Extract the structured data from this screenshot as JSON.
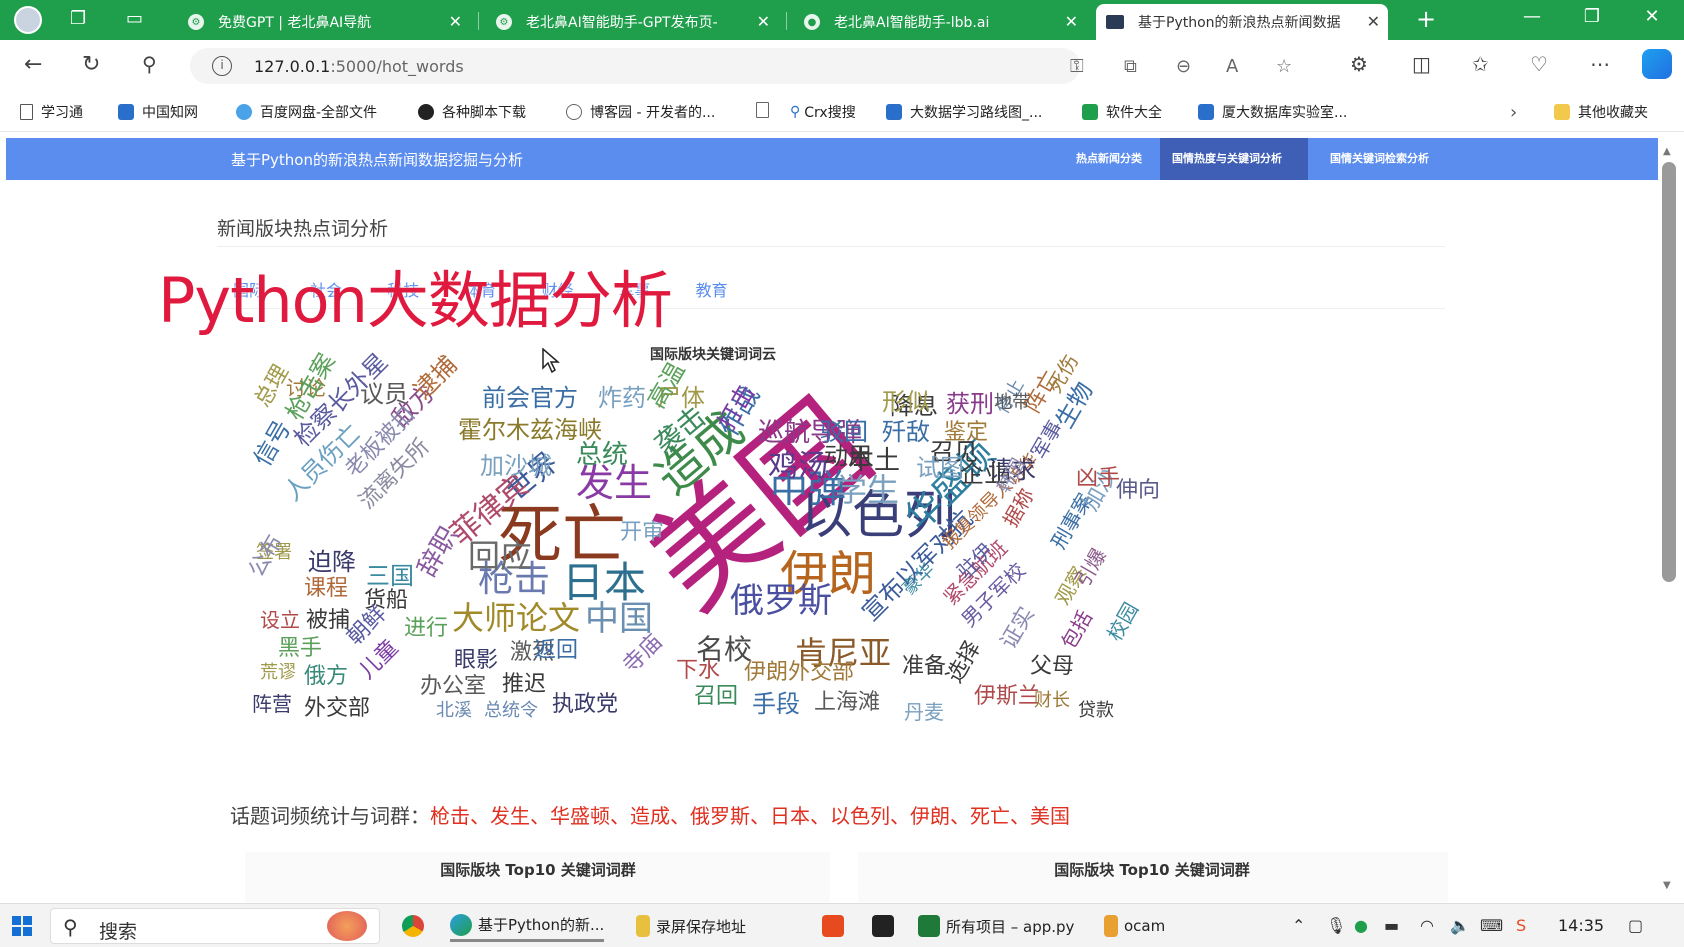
{
  "browser": {
    "tabs": [
      {
        "label": "免费GPT | 老北鼻AI导航",
        "active": false
      },
      {
        "label": "老北鼻AI智能助手-GPT发布页-",
        "active": false
      },
      {
        "label": "老北鼻AI智能助手-lbb.ai",
        "active": false
      },
      {
        "label": "基于Python的新浪热点新闻数据",
        "active": true
      }
    ],
    "url_host": "127.0.0.1",
    "url_path": ":5000/hot_words",
    "bookmarks": [
      {
        "label": "学习通",
        "color": "#555555"
      },
      {
        "label": "中国知网",
        "color": "#2a6fc9"
      },
      {
        "label": "百度网盘-全部文件",
        "color": "#4aa3e8"
      },
      {
        "label": "各种脚本下载",
        "color": "#222222"
      },
      {
        "label": "博客园 - 开发者的...",
        "color": "#666666"
      },
      {
        "label": "",
        "color": "#888888"
      },
      {
        "label": "Crx搜搜",
        "color": "#2a6fc9"
      },
      {
        "label": "大数据学习路线图_...",
        "color": "#2a6fc9"
      },
      {
        "label": "软件大全",
        "color": "#1f9e4c"
      },
      {
        "label": "厦大数据库实验室...",
        "color": "#2a6fc9"
      }
    ],
    "other_bookmarks": "其他收藏夹"
  },
  "app": {
    "brand": "基于Python的新浪热点新闻数据挖掘与分析",
    "nav": [
      {
        "label": "热点新闻分类",
        "active": false
      },
      {
        "label": "国情热度与关键词分析",
        "active": true
      },
      {
        "label": "国情关键词检索分析",
        "active": false
      }
    ],
    "section_title": "新闻版块热点词分析",
    "category_tabs": [
      "国际",
      "社会",
      "科技",
      "体育",
      "财经",
      "军事",
      "教育"
    ],
    "overlay_text": "Python大数据分析",
    "cloud_title": "国际版块关键词词云",
    "topic_label": "话题词频统计与词群：",
    "topic_words": "枪击、发生、华盛顿、造成、俄罗斯、日本、以色列、伊朗、死亡、美国",
    "panel_left_title": "国际版块 Top10 关键词词群",
    "panel_right_title": "国际版块 Top10 关键词词群"
  },
  "wordcloud": [
    {
      "text": "美国",
      "color": "#b5227e",
      "rot": -40
    },
    {
      "text": "死亡",
      "color": "#8a3a1f",
      "rot": 0
    },
    {
      "text": "以色列",
      "color": "#3a3f7a",
      "rot": 0
    },
    {
      "text": "伊朗",
      "color": "#b5651d",
      "rot": 0
    },
    {
      "text": "日本",
      "color": "#2d6f8f",
      "rot": 0
    },
    {
      "text": "造成",
      "color": "#3d8a4a",
      "rot": -40
    },
    {
      "text": "中弹",
      "color": "#3a6ea5",
      "rot": 0
    },
    {
      "text": "发生",
      "color": "#8a3aa5",
      "rot": 0
    },
    {
      "text": "俄罗斯",
      "color": "#4a4fa0",
      "rot": 0
    },
    {
      "text": "华盛顿",
      "color": "#2d7fa0",
      "rot": -45
    },
    {
      "text": "枪击",
      "color": "#6a7ab0",
      "rot": 0
    },
    {
      "text": "中国",
      "color": "#6a8fb0",
      "rot": 0
    },
    {
      "text": "大师论文",
      "color": "#a08a2a",
      "rot": 0
    },
    {
      "text": "回应",
      "color": "#6a6a6a",
      "rot": 0
    },
    {
      "text": "学生",
      "color": "#7aa0c0",
      "rot": 0
    },
    {
      "text": "肯尼亚",
      "color": "#8a5a2a",
      "rot": 0
    },
    {
      "text": "名校",
      "color": "#4a4a4a",
      "rot": 0
    },
    {
      "text": "宣布以军对抗",
      "color": "#3a5a9a",
      "rot": -45
    },
    {
      "text": "巡航导弹",
      "color": "#8a3a8a",
      "rot": 0
    },
    {
      "text": "鸡汤",
      "color": "#5a3a8a",
      "rot": 0
    },
    {
      "text": "本土",
      "color": "#3a3a3a",
      "rot": 0
    },
    {
      "text": "总统",
      "color": "#3a8a5a",
      "rot": 0
    },
    {
      "text": "袭击",
      "color": "#3a8a5a",
      "rot": -40
    },
    {
      "text": "作战",
      "color": "#3a6ea5",
      "rot": -60
    },
    {
      "text": "打击",
      "color": "#7a3aa5",
      "rot": -60
    },
    {
      "text": "世界",
      "color": "#3a5a9a",
      "rot": -40
    },
    {
      "text": "菲律宾",
      "color": "#b04a6a",
      "rot": -40
    },
    {
      "text": "前会官方",
      "color": "#3a6ea5",
      "rot": 0
    },
    {
      "text": "炸药",
      "color": "#7aa0c0",
      "rot": 0
    },
    {
      "text": "尸体",
      "color": "#a09a4a",
      "rot": 0
    },
    {
      "text": "霍尔木兹海峡",
      "color": "#8a7a2a",
      "rot": 0
    },
    {
      "text": "加沙城",
      "color": "#7aa0c0",
      "rot": 0
    },
    {
      "text": "高温",
      "color": "#5aa05a",
      "rot": -60
    },
    {
      "text": "议员",
      "color": "#5a5a5a",
      "rot": 0
    },
    {
      "text": "讨论",
      "color": "#a07a3a",
      "rot": 0
    },
    {
      "text": "总理",
      "color": "#a09a4a",
      "rot": -60
    },
    {
      "text": "枪击案",
      "color": "#5aa05a",
      "rot": -60
    },
    {
      "text": "检察长外星",
      "color": "#5a5aa0",
      "rot": -45
    },
    {
      "text": "信号",
      "color": "#3a6ea5",
      "rot": -60
    },
    {
      "text": "敌方",
      "color": "#8a4a8a",
      "rot": -45
    },
    {
      "text": "逮捕",
      "color": "#b06a3a",
      "rot": -45
    },
    {
      "text": "人员伤亡",
      "color": "#6aa0c0",
      "rot": -45
    },
    {
      "text": "老板被扣",
      "color": "#8a8ab0",
      "rot": -45
    },
    {
      "text": "流离失所",
      "color": "#8a8aa0",
      "rot": -45
    },
    {
      "text": "迫降",
      "color": "#3a3a6a",
      "rot": 0
    },
    {
      "text": "三国",
      "color": "#3a8aa0",
      "rot": 0
    },
    {
      "text": "辞职",
      "color": "#8a5aa0",
      "rot": -60
    },
    {
      "text": "课程",
      "color": "#b06a3a",
      "rot": 0
    },
    {
      "text": "货船",
      "color": "#3a3a3a",
      "rot": 0
    },
    {
      "text": "被捕",
      "color": "#3a3a3a",
      "rot": 0
    },
    {
      "text": "设立",
      "color": "#b04a4a",
      "rot": 0
    },
    {
      "text": "进行",
      "color": "#5aa05a",
      "rot": 0
    },
    {
      "text": "黑手",
      "color": "#5aa05a",
      "rot": 0
    },
    {
      "text": "朝鲜",
      "color": "#5a5aa0",
      "rot": -45
    },
    {
      "text": "眼影",
      "color": "#3a3a6a",
      "rot": 0
    },
    {
      "text": "激烈",
      "color": "#5a5a5a",
      "rot": 0
    },
    {
      "text": "返回",
      "color": "#3a6ea5",
      "rot": 0
    },
    {
      "text": "荒谬",
      "color": "#a09a4a",
      "rot": 0
    },
    {
      "text": "俄方",
      "color": "#3a8a7a",
      "rot": 0
    },
    {
      "text": "儿童",
      "color": "#7a3aa5",
      "rot": -45
    },
    {
      "text": "办公室",
      "color": "#5a5a5a",
      "rot": 0
    },
    {
      "text": "推迟",
      "color": "#3a3a3a",
      "rot": 0
    },
    {
      "text": "阵营",
      "color": "#3a3a6a",
      "rot": 0
    },
    {
      "text": "外交部",
      "color": "#3a3a3a",
      "rot": 0
    },
    {
      "text": "北溪",
      "color": "#6a8ab0",
      "rot": 0
    },
    {
      "text": "总统令",
      "color": "#6a8ab0",
      "rot": 0
    },
    {
      "text": "执政党",
      "color": "#3a3a6a",
      "rot": 0
    },
    {
      "text": "手段",
      "color": "#3a6ea5",
      "rot": 0
    },
    {
      "text": "上海滩",
      "color": "#5a5a5a",
      "rot": 0
    },
    {
      "text": "召回",
      "color": "#3a8a5a",
      "rot": 0
    },
    {
      "text": "伊朗外交部",
      "color": "#a07a3a",
      "rot": 0
    },
    {
      "text": "下水",
      "color": "#b04a4a",
      "rot": 0
    },
    {
      "text": "寺庙",
      "color": "#8a6ab0",
      "rot": -45
    },
    {
      "text": "准备",
      "color": "#3a3a3a",
      "rot": 0
    },
    {
      "text": "丹麦",
      "color": "#7aa0c0",
      "rot": 0
    },
    {
      "text": "选择",
      "color": "#3a3a3a",
      "rot": -60
    },
    {
      "text": "伊斯兰",
      "color": "#b04a4a",
      "rot": 0
    },
    {
      "text": "财长",
      "color": "#a07a3a",
      "rot": 0
    },
    {
      "text": "贷款",
      "color": "#3a3a3a",
      "rot": 0
    },
    {
      "text": "父母",
      "color": "#3a3a3a",
      "rot": 0
    },
    {
      "text": "包括",
      "color": "#8a3a8a",
      "rot": -60
    },
    {
      "text": "校园",
      "color": "#3a8aa0",
      "rot": -60
    },
    {
      "text": "证实",
      "color": "#8a8ab0",
      "rot": -60
    },
    {
      "text": "男子军校",
      "color": "#6a5aa0",
      "rot": -45
    },
    {
      "text": "紧急航班",
      "color": "#b04a6a",
      "rot": -45
    },
    {
      "text": "豪华",
      "color": "#3a8aa0",
      "rot": -45
    },
    {
      "text": "报复领导人访华",
      "color": "#b06a3a",
      "rot": -45
    },
    {
      "text": "驻伊",
      "color": "#5a5aa0",
      "rot": -45
    },
    {
      "text": "据称",
      "color": "#b04a4a",
      "rot": -60
    },
    {
      "text": "刑事案",
      "color": "#3a6ea5",
      "rot": -60
    },
    {
      "text": "观察",
      "color": "#a09a4a",
      "rot": -60
    },
    {
      "text": "引爆",
      "color": "#8a5a8a",
      "rot": -60
    },
    {
      "text": "加沙",
      "color": "#7aa0c0",
      "rot": -60
    },
    {
      "text": "伸向",
      "color": "#5a5a8a",
      "rot": 0
    },
    {
      "text": "凶手",
      "color": "#b04a4a",
      "rot": 0
    },
    {
      "text": "军事",
      "color": "#5a5aa0",
      "rot": -60
    },
    {
      "text": "生物",
      "color": "#3a6ea5",
      "rot": -60
    },
    {
      "text": "阵亡",
      "color": "#b06a3a",
      "rot": -60
    },
    {
      "text": "死伤",
      "color": "#a07a3a",
      "rot": -60
    },
    {
      "text": "停止",
      "color": "#6a8ab0",
      "rot": -60
    },
    {
      "text": "地带",
      "color": "#5a5a5a",
      "rot": 0
    },
    {
      "text": "获刑",
      "color": "#8a3a8a",
      "rot": 0
    },
    {
      "text": "鉴定",
      "color": "#a07a3a",
      "rot": 0
    },
    {
      "text": "降息",
      "color": "#3a3a3a",
      "rot": 0
    },
    {
      "text": "形似",
      "color": "#a09a4a",
      "rot": 0
    },
    {
      "text": "驳回",
      "color": "#3a6ea5",
      "rot": 0
    },
    {
      "text": "歼敌",
      "color": "#3a6ea5",
      "rot": 0
    },
    {
      "text": "召见",
      "color": "#3a3a3a",
      "rot": 0
    },
    {
      "text": "请求",
      "color": "#3a3a6a",
      "rot": 0
    },
    {
      "text": "动用",
      "color": "#3a3a3a",
      "rot": 0
    },
    {
      "text": "试图",
      "color": "#7aa0c0",
      "rot": 0
    },
    {
      "text": "企业",
      "color": "#3a3a3a",
      "rot": 0
    },
    {
      "text": "开审",
      "color": "#7aa0c0",
      "rot": 0
    },
    {
      "text": "签署",
      "color": "#a09a4a",
      "rot": 0
    },
    {
      "text": "公布",
      "color": "#8a8ab0",
      "rot": -60
    },
    {
      "text": "韩国",
      "color": "#8a8ab0",
      "rot": -60
    }
  ],
  "taskbar": {
    "search_label": "搜索",
    "items": [
      {
        "label": "",
        "color": "#e8a030"
      },
      {
        "label": "基于Python的新...",
        "color": "#1f9e4c"
      },
      {
        "label": "录屏保存地址",
        "color": "#e8c040"
      },
      {
        "label": "",
        "color": "#e84a20"
      },
      {
        "label": "",
        "color": "#222222"
      },
      {
        "label": "所有项目 – app.py",
        "color": "#1f7a3a"
      },
      {
        "label": "ocam",
        "color": "#e8a030"
      }
    ],
    "clock": "14:35"
  }
}
